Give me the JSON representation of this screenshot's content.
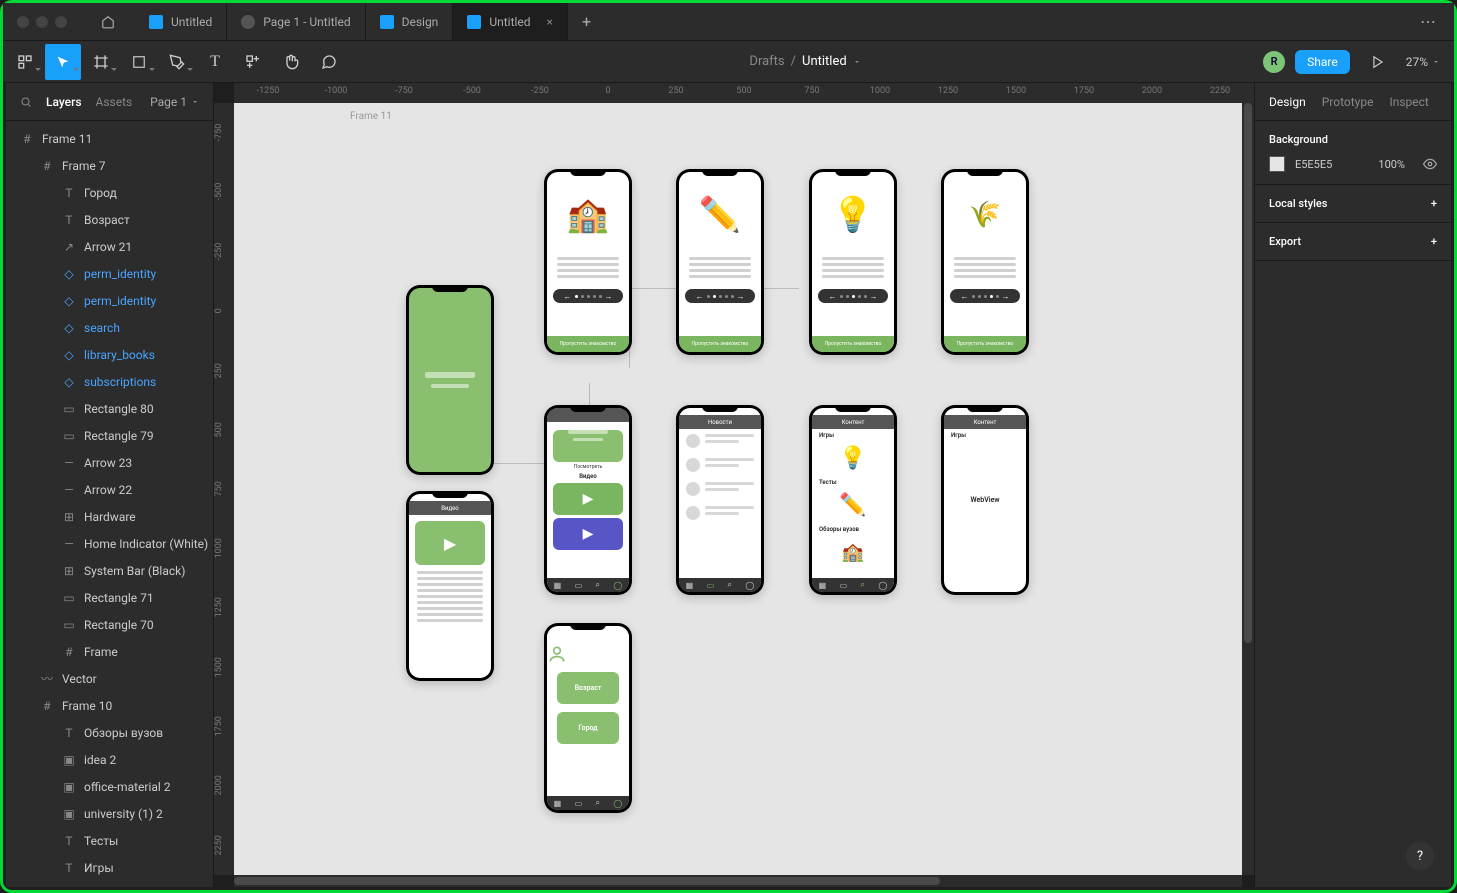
{
  "tabs": [
    {
      "label": "Untitled",
      "type": "figma"
    },
    {
      "label": "Page 1 - Untitled",
      "type": "proto"
    },
    {
      "label": "Design",
      "type": "figma"
    },
    {
      "label": "Untitled",
      "type": "figma",
      "active": true
    }
  ],
  "breadcrumb": {
    "parent": "Drafts",
    "current": "Untitled"
  },
  "avatar_initial": "R",
  "share_label": "Share",
  "zoom": "27%",
  "leftpanel": {
    "tab_layers": "Layers",
    "tab_assets": "Assets",
    "page": "Page 1",
    "layers": [
      {
        "icon": "frame",
        "label": "Frame 11",
        "indent": 0
      },
      {
        "icon": "frame",
        "label": "Frame 7",
        "indent": 1
      },
      {
        "icon": "text",
        "label": "Город",
        "indent": 2
      },
      {
        "icon": "text",
        "label": "Возраст",
        "indent": 2
      },
      {
        "icon": "arrow",
        "label": "Arrow 21",
        "indent": 2
      },
      {
        "icon": "component",
        "label": "perm_identity",
        "indent": 2,
        "blue": true
      },
      {
        "icon": "component",
        "label": "perm_identity",
        "indent": 2,
        "blue": true
      },
      {
        "icon": "component",
        "label": "search",
        "indent": 2,
        "blue": true
      },
      {
        "icon": "component",
        "label": "library_books",
        "indent": 2,
        "blue": true
      },
      {
        "icon": "component",
        "label": "subscriptions",
        "indent": 2,
        "blue": true
      },
      {
        "icon": "rect",
        "label": "Rectangle 80",
        "indent": 2
      },
      {
        "icon": "rect",
        "label": "Rectangle 79",
        "indent": 2
      },
      {
        "icon": "line",
        "label": "Arrow 23",
        "indent": 2
      },
      {
        "icon": "line",
        "label": "Arrow 22",
        "indent": 2
      },
      {
        "icon": "group",
        "label": "Hardware",
        "indent": 2
      },
      {
        "icon": "line",
        "label": "Home Indicator (White)",
        "indent": 2
      },
      {
        "icon": "group",
        "label": "System Bar (Black)",
        "indent": 2
      },
      {
        "icon": "rect",
        "label": "Rectangle 71",
        "indent": 2
      },
      {
        "icon": "rect",
        "label": "Rectangle 70",
        "indent": 2
      },
      {
        "icon": "frame",
        "label": "Frame",
        "indent": 2
      },
      {
        "icon": "vector",
        "label": "Vector",
        "indent": 1
      },
      {
        "icon": "frame",
        "label": "Frame 10",
        "indent": 1
      },
      {
        "icon": "text",
        "label": "Обзоры вузов",
        "indent": 2
      },
      {
        "icon": "image",
        "label": "idea 2",
        "indent": 2
      },
      {
        "icon": "image",
        "label": "office-material 2",
        "indent": 2
      },
      {
        "icon": "image",
        "label": "university (1) 2",
        "indent": 2
      },
      {
        "icon": "text",
        "label": "Тесты",
        "indent": 2
      },
      {
        "icon": "text",
        "label": "Игры",
        "indent": 2
      }
    ]
  },
  "ruler_h": [
    "-1250",
    "-1000",
    "-750",
    "-500",
    "-250",
    "0",
    "250",
    "500",
    "750",
    "1000",
    "1250",
    "1500",
    "1750",
    "2000",
    "2250"
  ],
  "ruler_v": [
    "-750",
    "-500",
    "-250",
    "0",
    "250",
    "500",
    "750",
    "1000",
    "1250",
    "1500",
    "1750",
    "2000",
    "2250"
  ],
  "canvas": {
    "frame_label": "Frame 11",
    "skip_label": "Пропустить знакомство",
    "headers": {
      "video": "Видео",
      "news": "Новости",
      "content": "Контент",
      "games": "Игры",
      "tests": "Тесты",
      "reviews": "Обзоры вузов",
      "look": "Посмотреть",
      "webview": "WebView"
    },
    "profile": {
      "age": "Возраст",
      "city": "Город"
    }
  },
  "rightpanel": {
    "tab_design": "Design",
    "tab_prototype": "Prototype",
    "tab_inspect": "Inspect",
    "background_label": "Background",
    "bg_hex": "E5E5E5",
    "bg_opacity": "100%",
    "local_styles": "Local styles",
    "export": "Export"
  }
}
